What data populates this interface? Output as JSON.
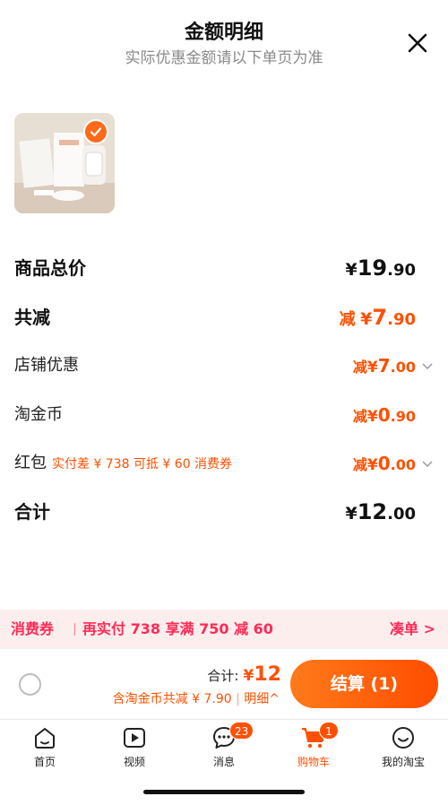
{
  "header": {
    "title": "金额明细",
    "subtitle": "实际优惠金额请以下单页为准",
    "close_icon": "close-icon"
  },
  "product": {
    "selected": true,
    "check_icon": "checkmark-icon"
  },
  "summary": {
    "goods_total": {
      "label": "商品总价",
      "currency": "¥",
      "int": "19",
      "dec": ".90"
    },
    "total_reduce": {
      "label": "共减",
      "prefix": "减",
      "currency": "¥",
      "int": "7",
      "dec": ".90"
    },
    "shop_discount": {
      "label": "店铺优惠",
      "prefix": "减",
      "currency": "¥",
      "int": "7",
      "dec": ".00"
    },
    "taojinbi": {
      "label": "淘金币",
      "prefix": "减",
      "currency": "¥",
      "int": "0",
      "dec": ".90"
    },
    "red_packet": {
      "label": "红包",
      "note": "实付差 ¥ 738 可抵 ¥ 60 消费券",
      "prefix": "减",
      "currency": "¥",
      "int": "0",
      "dec": ".00"
    },
    "total": {
      "label": "合计",
      "currency": "¥",
      "int": "12",
      "dec": ".00"
    }
  },
  "promo": {
    "tag": "消费券",
    "text": "再实付 738 享满 750 减 60",
    "link": "凑单 >"
  },
  "checkout": {
    "total_label": "合计:",
    "currency": "¥",
    "total_value": "12",
    "discount_text": "含淘金币共减 ¥ 7.90",
    "detail_link": "明细^",
    "pay_button": "结算 (1)"
  },
  "tabbar": {
    "items": [
      {
        "label": "首页",
        "icon": "home-icon"
      },
      {
        "label": "视频",
        "icon": "video-icon"
      },
      {
        "label": "消息",
        "icon": "message-icon",
        "badge": "23"
      },
      {
        "label": "购物车",
        "icon": "cart-icon",
        "badge": "1",
        "active": true
      },
      {
        "label": "我的淘宝",
        "icon": "profile-icon"
      }
    ]
  },
  "colors": {
    "accent": "#ff5000",
    "promo_text": "#ff2a55",
    "promo_bg": "#fdeeee"
  }
}
